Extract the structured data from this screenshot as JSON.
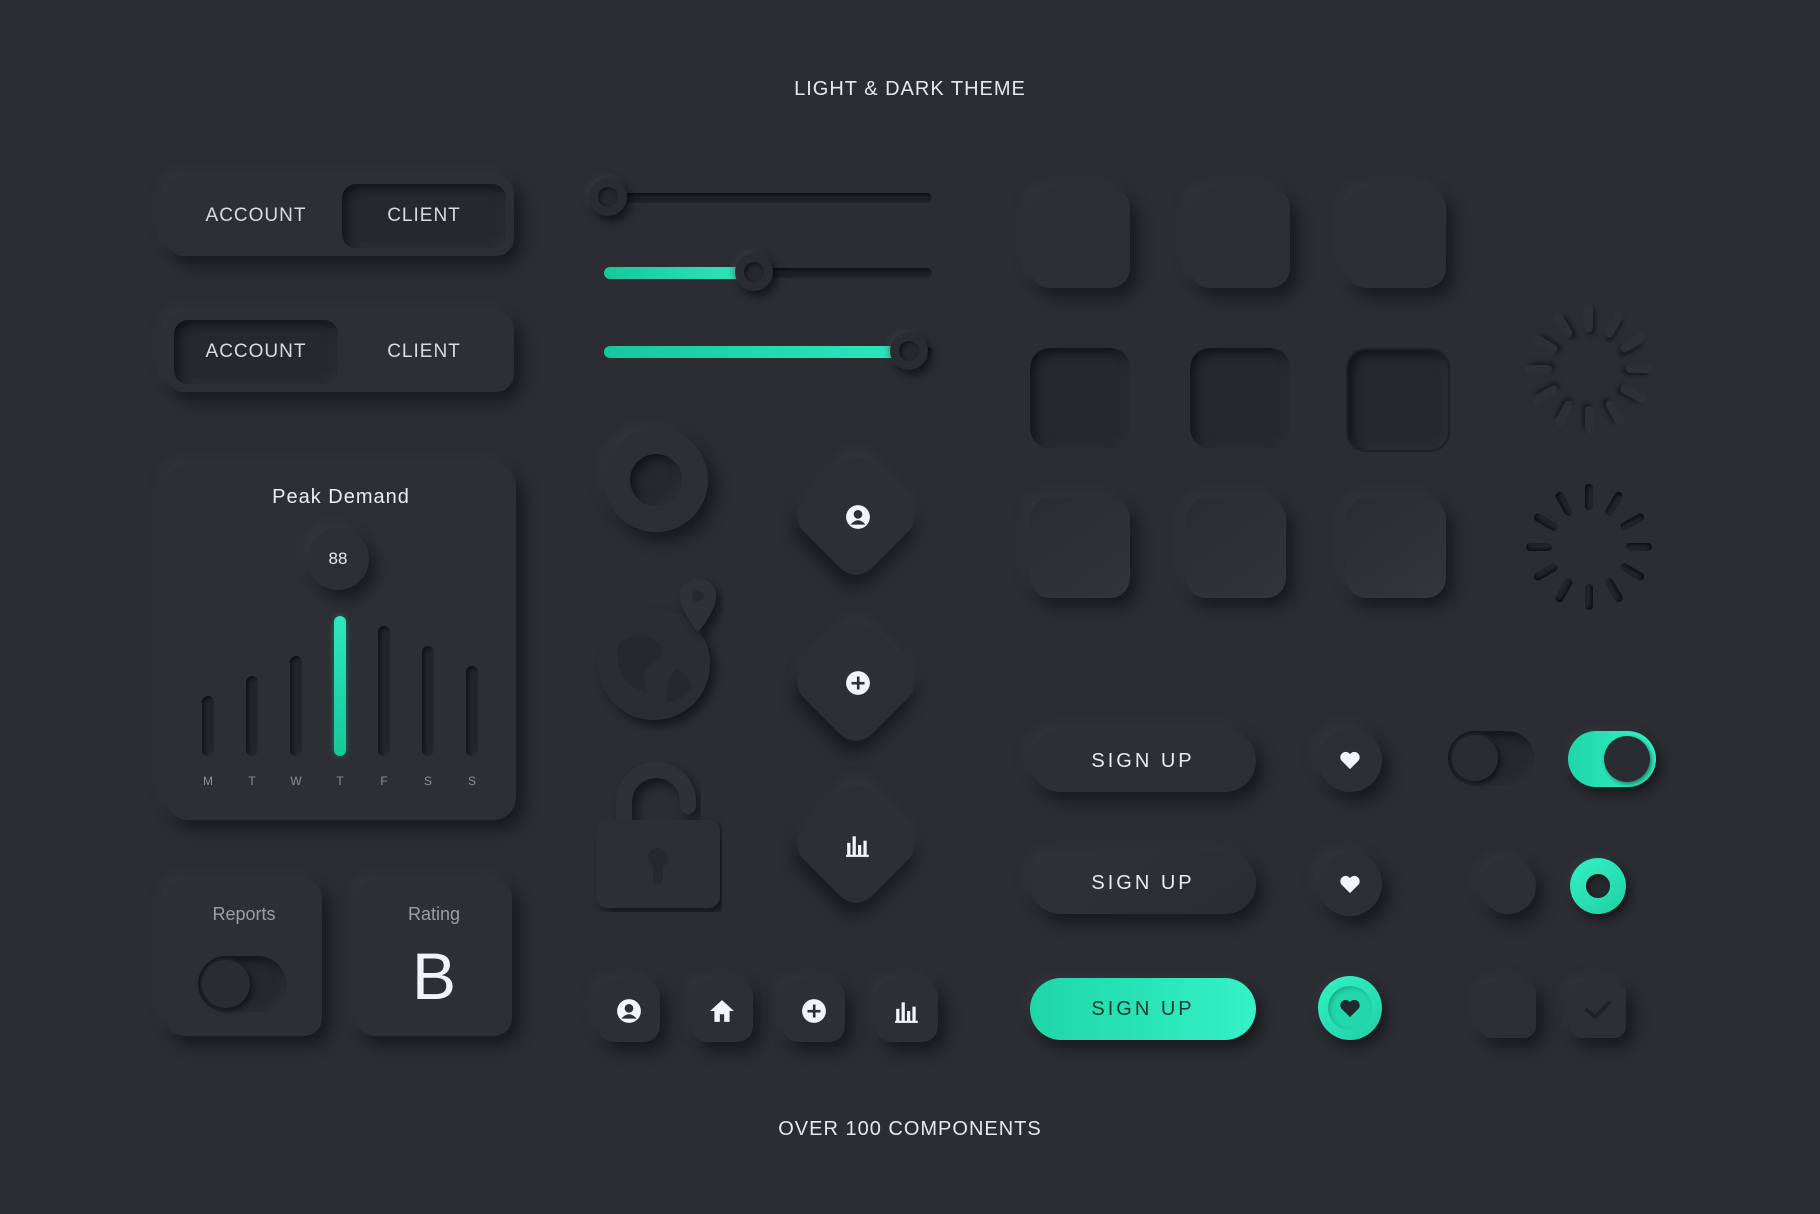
{
  "header": {
    "title": "LIGHT & DARK THEME"
  },
  "footer": {
    "caption": "OVER 100 COMPONENTS"
  },
  "segmented_controls": [
    {
      "options": [
        "ACCOUNT",
        "CLIENT"
      ],
      "selected": "CLIENT"
    },
    {
      "options": [
        "ACCOUNT",
        "CLIENT"
      ],
      "selected": "ACCOUNT"
    }
  ],
  "sliders": [
    {
      "value": 0.0
    },
    {
      "value": 0.45
    },
    {
      "value": 0.93
    }
  ],
  "peak_demand": {
    "title": "Peak Demand",
    "value": "88",
    "days": [
      "M",
      "T",
      "W",
      "T",
      "F",
      "S",
      "S"
    ],
    "active_day_index": 3
  },
  "reports_card": {
    "label": "Reports",
    "toggle_on": false
  },
  "rating_card": {
    "label": "Rating",
    "grade": "B"
  },
  "buttons": {
    "signup_1": "SIGN UP",
    "signup_2": "SIGN UP",
    "signup_3": "SIGN UP"
  },
  "colors": {
    "accent": "#2ee8bd",
    "background": "#2b2d33"
  }
}
